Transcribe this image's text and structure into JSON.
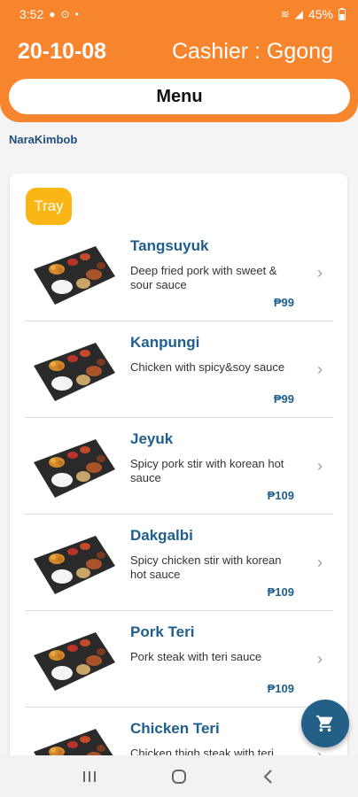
{
  "status_bar": {
    "time": "3:52",
    "battery": "45%"
  },
  "header": {
    "date": "20-10-08",
    "cashier": "Cashier : Ggong",
    "menu_label": "Menu"
  },
  "store_name": "NaraKimbob",
  "category": "Tray",
  "items": [
    {
      "name": "Tangsuyuk",
      "desc": "Deep fried pork with sweet & sour sauce",
      "price": "₱99"
    },
    {
      "name": "Kanpungi",
      "desc": "Chicken with spicy&soy sauce",
      "price": "₱99"
    },
    {
      "name": "Jeyuk",
      "desc": "Spicy pork stir with korean hot sauce",
      "price": "₱109"
    },
    {
      "name": "Dakgalbi",
      "desc": "Spicy chicken stir with korean hot sauce",
      "price": "₱109"
    },
    {
      "name": "Pork Teri",
      "desc": "Pork steak with teri sauce",
      "price": "₱109"
    },
    {
      "name": "Chicken Teri",
      "desc": "Chicken thigh steak with teri",
      "price": ""
    }
  ],
  "icons": {
    "cart": "cart-icon",
    "chevron": "chevron-right-icon",
    "recents": "recents-icon",
    "home": "home-icon",
    "back": "back-icon"
  },
  "colors": {
    "header": "#f7852d",
    "accent_blue": "#1f5f8e",
    "tray_badge": "#fbb615",
    "fab": "#235f86"
  }
}
